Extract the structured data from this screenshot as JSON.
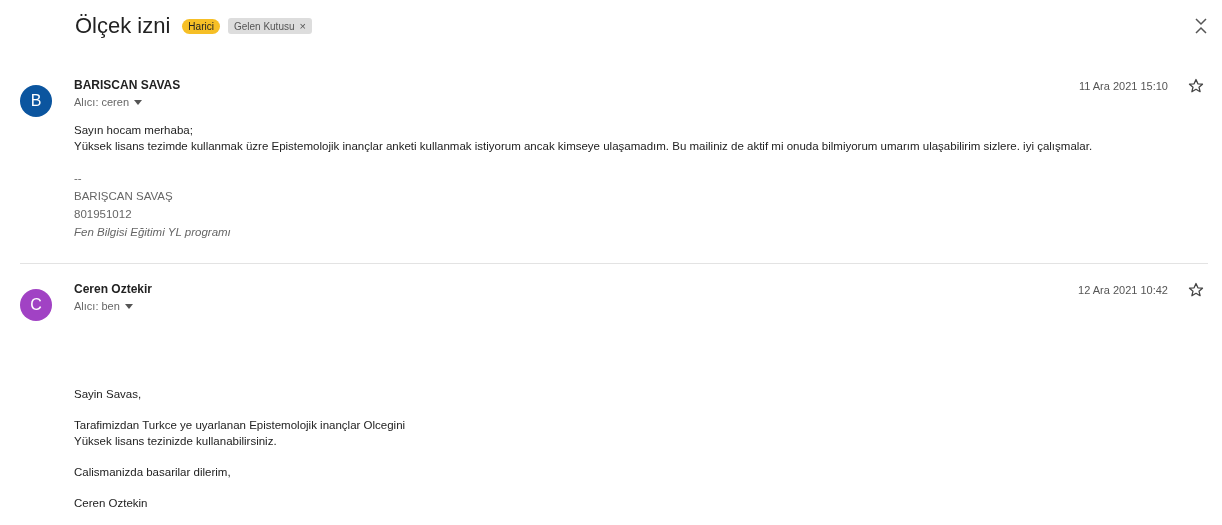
{
  "subject": "Ölçek izni",
  "labels": [
    {
      "text": "Harici",
      "color": "#f6bf26",
      "removable": false
    },
    {
      "text": "Gelen Kutusu",
      "color": "#dddddd",
      "removable": true,
      "remove_glyph": "×"
    }
  ],
  "messages": [
    {
      "avatar": "B",
      "color": "#0b559f",
      "sender": "BARISCAN SAVAS",
      "recipient": "Alıcı: ceren",
      "date": "11 Ara 2021 15:10",
      "starred": false,
      "kind": "signed",
      "paragraphs": [
        [
          "Sayın hocam merhaba;",
          "Yüksek lisans tezimde kullanmak üzre Epistemolojik inançlar anketi kullanmak istiyorum ancak kimseye ulaşamadım. Bu mailiniz de aktif mi onuda bilmiyorum umarım ulaşabilirim sizlere. iyi çalışmalar."
        ]
      ],
      "signature": [
        {
          "kind": "plain",
          "text": "--"
        },
        {
          "kind": "plain",
          "text": "BARIŞCAN SAVAŞ"
        },
        {
          "kind": "plain",
          "text": "801951012"
        },
        {
          "kind": "italic",
          "text": "Fen Bilgisi Eğitimi YL programı"
        }
      ]
    },
    {
      "avatar": "C",
      "color": "#a142c4",
      "sender": "Ceren Oztekir",
      "recipient": "Alıcı: ben",
      "date": "12 Ara 2021 10:42",
      "starred": false,
      "kind": "gapped",
      "paragraphs": [
        [
          "Sayin Savas,"
        ],
        [
          "Tarafimizdan Turkce ye uyarlanan Epistemolojik inançlar Olcegini",
          "Yüksek lisans tezinizde kullanabilirsiniz."
        ],
        [
          "Calismanizda basarilar dilerim,"
        ],
        [
          "Ceren Oztekin"
        ]
      ]
    }
  ]
}
